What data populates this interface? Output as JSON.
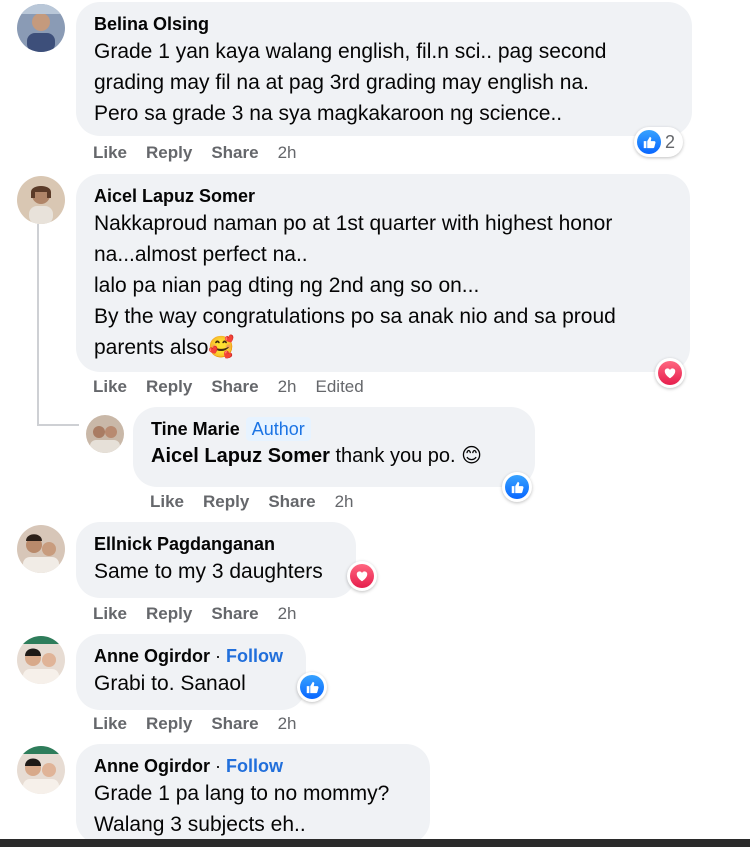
{
  "comments": [
    {
      "name": "Belina Olsing",
      "lines": [
        "Grade 1 yan kaya walang english, fil.n sci.. pag second",
        "grading may fil na at pag 3rd grading may english na.",
        "Pero sa grade 3 na sya magkakaroon ng science.."
      ],
      "actions": {
        "like": "Like",
        "reply": "Reply",
        "share": "Share",
        "time": "2h"
      },
      "reaction_count": "2",
      "reaction_icon": "like-icon"
    },
    {
      "name": "Aicel Lapuz Somer",
      "lines": [
        "Nakkaproud naman po at 1st quarter with highest honor",
        "na...almost perfect na..",
        "lalo pa nian pag dting ng 2nd ang so on...",
        "By the way congratulations po sa anak nio and sa proud",
        "parents also🥰"
      ],
      "actions": {
        "like": "Like",
        "reply": "Reply",
        "share": "Share",
        "time": "2h",
        "edited": "Edited"
      },
      "reaction_icon": "heart-icon"
    },
    {
      "name": "Ellnick Pagdanganan",
      "lines": [
        "Same to my 3 daughters"
      ],
      "actions": {
        "like": "Like",
        "reply": "Reply",
        "share": "Share",
        "time": "2h"
      },
      "reaction_icon": "heart-icon"
    },
    {
      "name": "Anne Ogirdor",
      "separator": " · ",
      "follow": "Follow",
      "lines": [
        "Grabi to. Sanaol"
      ],
      "actions": {
        "like": "Like",
        "reply": "Reply",
        "share": "Share",
        "time": "2h"
      },
      "reaction_icon": "like-icon"
    },
    {
      "name": "Anne Ogirdor",
      "separator": " · ",
      "follow": "Follow",
      "lines": [
        "Grade 1 pa lang to no mommy?",
        "Walang 3 subjects eh.."
      ]
    }
  ],
  "reply": {
    "name": "Tine Marie",
    "badge": "Author",
    "mention": "Aicel Lapuz Somer",
    "text": " thank you po. 😊",
    "actions": {
      "like": "Like",
      "reply": "Reply",
      "share": "Share",
      "time": "2h"
    },
    "reaction_icon": "like-icon"
  },
  "colors": {
    "bubble": "#f0f2f5",
    "action_text": "#65676b",
    "link_blue": "#216fdb",
    "like_blue": "#0866ff",
    "heart_red": "#e61e4d"
  }
}
